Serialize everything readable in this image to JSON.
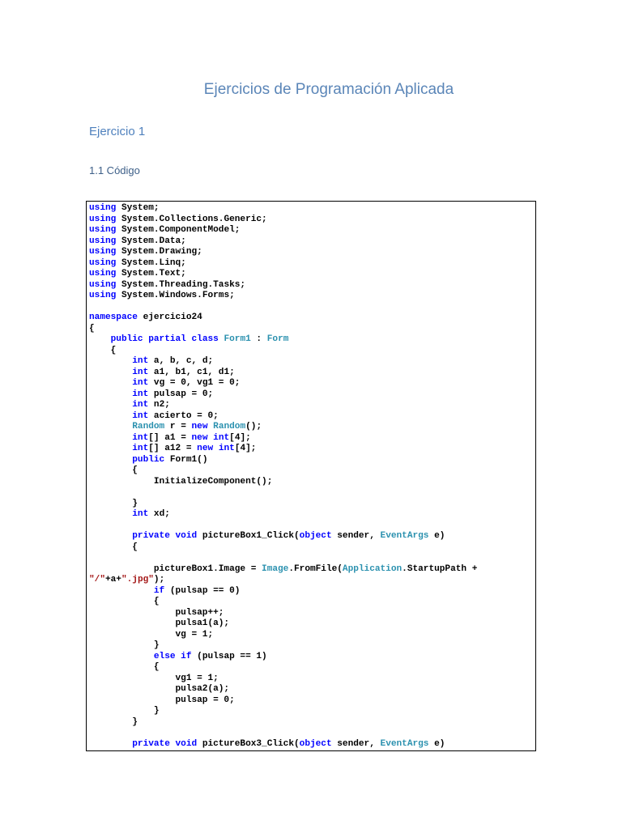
{
  "document": {
    "title": "Ejercicios de Programación Aplicada",
    "heading1": "Ejercicio 1",
    "heading2": "1.1 Código"
  },
  "colors": {
    "keyword": "#0000ff",
    "type": "#2b91af",
    "string": "#a31515",
    "heading": "#4f81bd"
  },
  "code_lines": [
    [
      [
        "k",
        "using"
      ],
      [
        "p",
        " System;"
      ]
    ],
    [
      [
        "k",
        "using"
      ],
      [
        "p",
        " System.Collections.Generic;"
      ]
    ],
    [
      [
        "k",
        "using"
      ],
      [
        "p",
        " System.ComponentModel;"
      ]
    ],
    [
      [
        "k",
        "using"
      ],
      [
        "p",
        " System.Data;"
      ]
    ],
    [
      [
        "k",
        "using"
      ],
      [
        "p",
        " System.Drawing;"
      ]
    ],
    [
      [
        "k",
        "using"
      ],
      [
        "p",
        " System.Linq;"
      ]
    ],
    [
      [
        "k",
        "using"
      ],
      [
        "p",
        " System.Text;"
      ]
    ],
    [
      [
        "k",
        "using"
      ],
      [
        "p",
        " System.Threading.Tasks;"
      ]
    ],
    [
      [
        "k",
        "using"
      ],
      [
        "p",
        " System.Windows.Forms;"
      ]
    ],
    [],
    [
      [
        "k",
        "namespace"
      ],
      [
        "p",
        " ejercicio24"
      ]
    ],
    [
      [
        "p",
        "{"
      ]
    ],
    [
      [
        "p",
        "    "
      ],
      [
        "k",
        "public partial class"
      ],
      [
        "p",
        " "
      ],
      [
        "t",
        "Form1"
      ],
      [
        "p",
        " : "
      ],
      [
        "t",
        "Form"
      ]
    ],
    [
      [
        "p",
        "    {"
      ]
    ],
    [
      [
        "p",
        "        "
      ],
      [
        "k",
        "int"
      ],
      [
        "p",
        " a, b, c, d;"
      ]
    ],
    [
      [
        "p",
        "        "
      ],
      [
        "k",
        "int"
      ],
      [
        "p",
        " a1, b1, c1, d1;"
      ]
    ],
    [
      [
        "p",
        "        "
      ],
      [
        "k",
        "int"
      ],
      [
        "p",
        " vg = 0, vg1 = 0;"
      ]
    ],
    [
      [
        "p",
        "        "
      ],
      [
        "k",
        "int"
      ],
      [
        "p",
        " pulsap = 0;"
      ]
    ],
    [
      [
        "p",
        "        "
      ],
      [
        "k",
        "int"
      ],
      [
        "p",
        " n2;"
      ]
    ],
    [
      [
        "p",
        "        "
      ],
      [
        "k",
        "int"
      ],
      [
        "p",
        " acierto = 0;"
      ]
    ],
    [
      [
        "p",
        "        "
      ],
      [
        "t",
        "Random"
      ],
      [
        "p",
        " r = "
      ],
      [
        "k",
        "new"
      ],
      [
        "p",
        " "
      ],
      [
        "t",
        "Random"
      ],
      [
        "p",
        "();"
      ]
    ],
    [
      [
        "p",
        "        "
      ],
      [
        "k",
        "int"
      ],
      [
        "p",
        "[] a1 = "
      ],
      [
        "k",
        "new"
      ],
      [
        "p",
        " "
      ],
      [
        "k",
        "int"
      ],
      [
        "p",
        "[4];"
      ]
    ],
    [
      [
        "p",
        "        "
      ],
      [
        "k",
        "int"
      ],
      [
        "p",
        "[] a12 = "
      ],
      [
        "k",
        "new"
      ],
      [
        "p",
        " "
      ],
      [
        "k",
        "int"
      ],
      [
        "p",
        "[4];"
      ]
    ],
    [
      [
        "p",
        "        "
      ],
      [
        "k",
        "public"
      ],
      [
        "p",
        " Form1()"
      ]
    ],
    [
      [
        "p",
        "        {"
      ]
    ],
    [
      [
        "p",
        "            InitializeComponent();"
      ]
    ],
    [],
    [
      [
        "p",
        "        }"
      ]
    ],
    [
      [
        "p",
        "        "
      ],
      [
        "k",
        "int"
      ],
      [
        "p",
        " xd;"
      ]
    ],
    [],
    [
      [
        "p",
        "        "
      ],
      [
        "k",
        "private void"
      ],
      [
        "p",
        " pictureBox1_Click("
      ],
      [
        "k",
        "object"
      ],
      [
        "p",
        " sender, "
      ],
      [
        "t",
        "EventArgs"
      ],
      [
        "p",
        " e)"
      ]
    ],
    [
      [
        "p",
        "        {"
      ]
    ],
    [],
    [
      [
        "p",
        "            pictureBox1.Image = "
      ],
      [
        "t",
        "Image"
      ],
      [
        "p",
        ".FromFile("
      ],
      [
        "t",
        "Application"
      ],
      [
        "p",
        ".StartupPath +"
      ]
    ],
    [
      [
        "s",
        "\"/\""
      ],
      [
        "p",
        "+a+"
      ],
      [
        "s",
        "\".jpg\""
      ],
      [
        "p",
        ");"
      ]
    ],
    [
      [
        "p",
        "            "
      ],
      [
        "k",
        "if"
      ],
      [
        "p",
        " (pulsap == 0)"
      ]
    ],
    [
      [
        "p",
        "            {"
      ]
    ],
    [
      [
        "p",
        "                pulsap++;"
      ]
    ],
    [
      [
        "p",
        "                pulsa1(a);"
      ]
    ],
    [
      [
        "p",
        "                vg = 1;"
      ]
    ],
    [
      [
        "p",
        "            }"
      ]
    ],
    [
      [
        "p",
        "            "
      ],
      [
        "k",
        "else if"
      ],
      [
        "p",
        " (pulsap == 1)"
      ]
    ],
    [
      [
        "p",
        "            {"
      ]
    ],
    [
      [
        "p",
        "                vg1 = 1;"
      ]
    ],
    [
      [
        "p",
        "                pulsa2(a);"
      ]
    ],
    [
      [
        "p",
        "                pulsap = 0;"
      ]
    ],
    [
      [
        "p",
        "            }"
      ]
    ],
    [
      [
        "p",
        "        }"
      ]
    ],
    [],
    [
      [
        "p",
        "        "
      ],
      [
        "k",
        "private void"
      ],
      [
        "p",
        " pictureBox3_Click("
      ],
      [
        "k",
        "object"
      ],
      [
        "p",
        " sender, "
      ],
      [
        "t",
        "EventArgs"
      ],
      [
        "p",
        " e)"
      ]
    ]
  ]
}
